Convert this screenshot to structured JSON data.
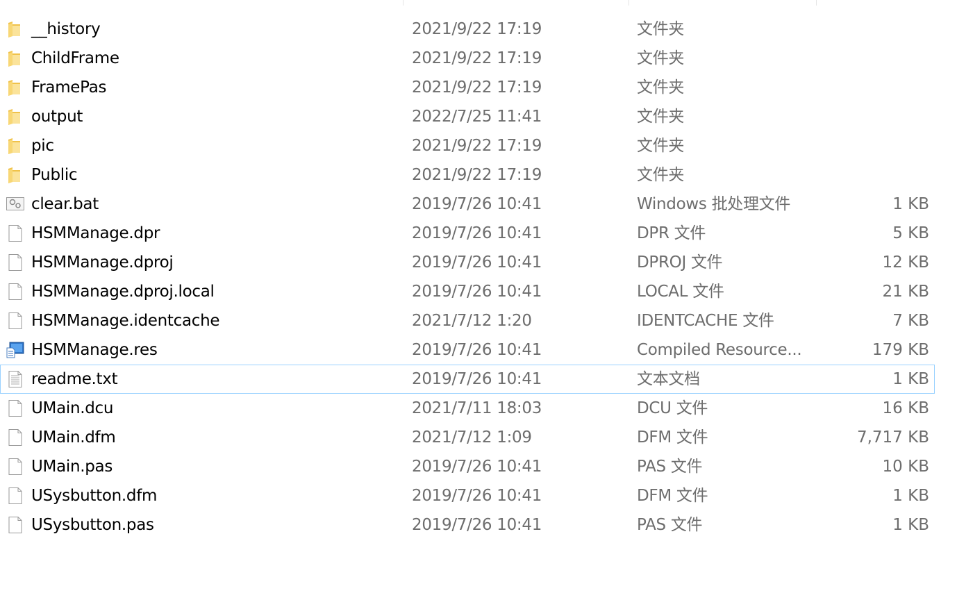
{
  "files": [
    {
      "name": "__history",
      "date": "2021/9/22 17:19",
      "type": "文件夹",
      "size": "",
      "icon": "folder-icon"
    },
    {
      "name": "ChildFrame",
      "date": "2021/9/22 17:19",
      "type": "文件夹",
      "size": "",
      "icon": "folder-icon"
    },
    {
      "name": "FramePas",
      "date": "2021/9/22 17:19",
      "type": "文件夹",
      "size": "",
      "icon": "folder-icon"
    },
    {
      "name": "output",
      "date": "2022/7/25 11:41",
      "type": "文件夹",
      "size": "",
      "icon": "folder-icon"
    },
    {
      "name": "pic",
      "date": "2021/9/22 17:19",
      "type": "文件夹",
      "size": "",
      "icon": "folder-icon"
    },
    {
      "name": "Public",
      "date": "2021/9/22 17:19",
      "type": "文件夹",
      "size": "",
      "icon": "folder-icon"
    },
    {
      "name": "clear.bat",
      "date": "2019/7/26 10:41",
      "type": "Windows 批处理文件",
      "size": "1 KB",
      "icon": "batch-file-icon"
    },
    {
      "name": "HSMManage.dpr",
      "date": "2019/7/26 10:41",
      "type": "DPR 文件",
      "size": "5 KB",
      "icon": "file-icon"
    },
    {
      "name": "HSMManage.dproj",
      "date": "2019/7/26 10:41",
      "type": "DPROJ 文件",
      "size": "12 KB",
      "icon": "file-icon"
    },
    {
      "name": "HSMManage.dproj.local",
      "date": "2019/7/26 10:41",
      "type": "LOCAL 文件",
      "size": "21 KB",
      "icon": "file-icon"
    },
    {
      "name": "HSMManage.identcache",
      "date": "2021/7/12 1:20",
      "type": "IDENTCACHE 文件",
      "size": "7 KB",
      "icon": "file-icon"
    },
    {
      "name": "HSMManage.res",
      "date": "2019/7/26 10:41",
      "type": "Compiled Resource...",
      "size": "179 KB",
      "icon": "resource-file-icon"
    },
    {
      "name": "readme.txt",
      "date": "2019/7/26 10:41",
      "type": "文本文档",
      "size": "1 KB",
      "icon": "text-file-icon",
      "hovered": true
    },
    {
      "name": "UMain.dcu",
      "date": "2021/7/11 18:03",
      "type": "DCU 文件",
      "size": "16 KB",
      "icon": "file-icon"
    },
    {
      "name": "UMain.dfm",
      "date": "2021/7/12 1:09",
      "type": "DFM 文件",
      "size": "7,717 KB",
      "icon": "file-icon"
    },
    {
      "name": "UMain.pas",
      "date": "2019/7/26 10:41",
      "type": "PAS 文件",
      "size": "10 KB",
      "icon": "file-icon"
    },
    {
      "name": "USysbutton.dfm",
      "date": "2019/7/26 10:41",
      "type": "DFM 文件",
      "size": "1 KB",
      "icon": "file-icon"
    },
    {
      "name": "USysbutton.pas",
      "date": "2019/7/26 10:41",
      "type": "PAS 文件",
      "size": "1 KB",
      "icon": "file-icon"
    }
  ],
  "colors": {
    "hover_border": "#99d1ff",
    "secondary_text": "#6d6d6d",
    "folder": "#f8d775"
  }
}
